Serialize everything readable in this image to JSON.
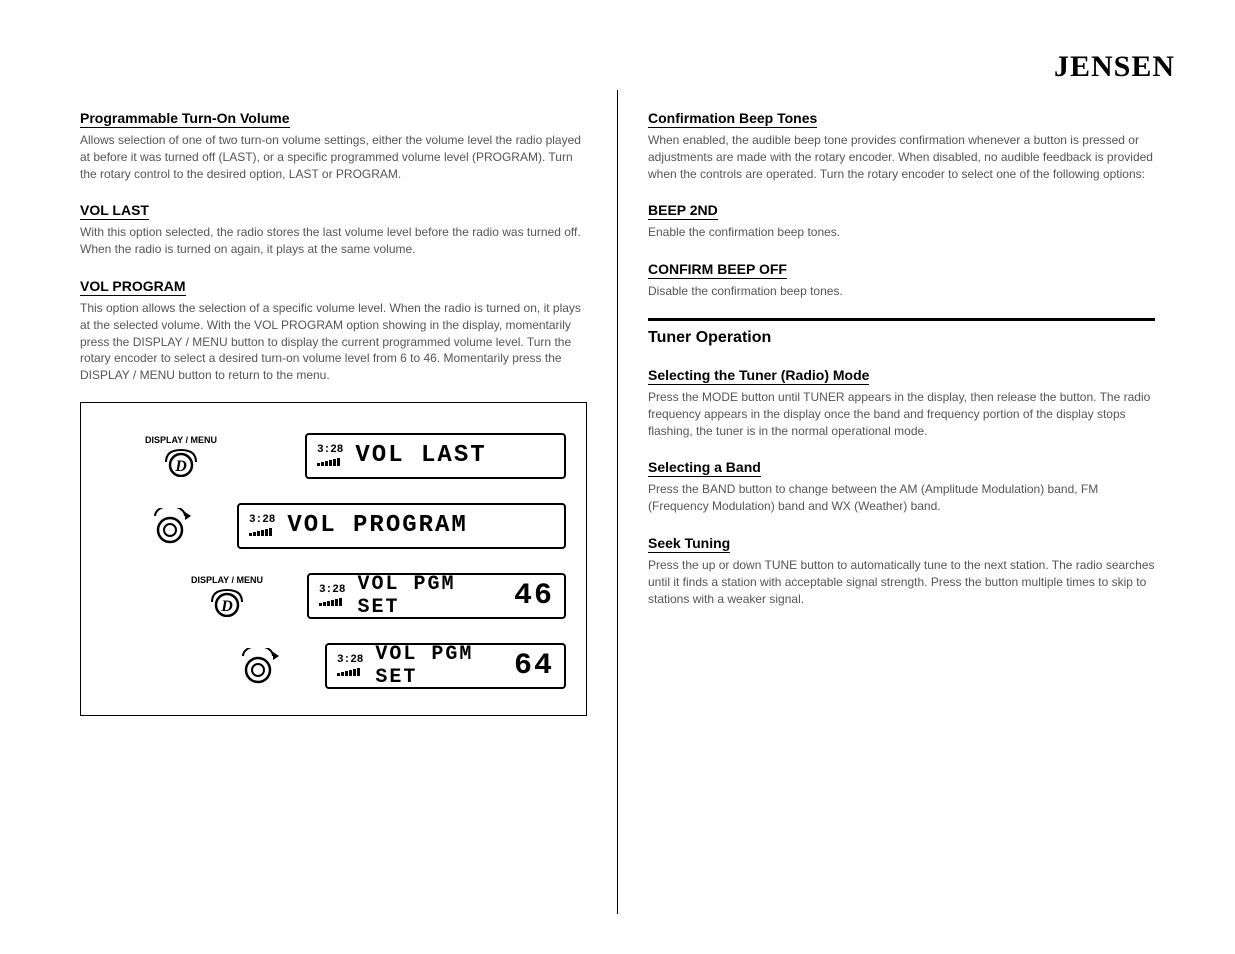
{
  "brand": "JENSEN",
  "left": {
    "sec1": {
      "title": "Programmable Turn-On Volume",
      "body": "Allows selection of one of two turn-on volume settings, either the volume level the radio played at before it was turned off (LAST), or a specific programmed volume level (PROGRAM). Turn the rotary control to the desired option, LAST or PROGRAM."
    },
    "last": {
      "title": "VOL LAST",
      "body": "With this option selected, the radio stores the last volume level before the radio was turned off. When the radio is turned on again, it plays at the same volume."
    },
    "program": {
      "title": "VOL PROGRAM",
      "body": "This option allows the selection of a specific volume level. When the radio is turned on, it plays at the selected volume. With the VOL PROGRAM option showing in the display, momentarily press the DISPLAY / MENU button to display the current programmed volume level. Turn the rotary encoder to select a desired turn-on volume level from 6 to 46. Momentarily press the DISPLAY / MENU button to return to the menu."
    },
    "illus": {
      "btnlabel": "DISPLAY / MENU",
      "clock": "3:28",
      "r1": "VOL LAST",
      "r2": "VOL PROGRAM",
      "r3a": "VOL PGM SET",
      "r3b": "46",
      "r4a": "VOL PGM SET",
      "r4b": "64"
    }
  },
  "right": {
    "beep": {
      "title": "Confirmation Beep Tones",
      "body": "When enabled, the audible beep tone provides confirmation whenever a button is pressed or adjustments are made with the rotary encoder. When disabled, no audible feedback is provided when the controls are operated. Turn the rotary encoder to select one of the following options:"
    },
    "on": {
      "title": "BEEP 2ND",
      "body": "Enable the confirmation beep tones."
    },
    "off": {
      "title": "CONFIRM BEEP OFF",
      "body": "Disable the confirmation beep tones."
    },
    "tuner_h": "Tuner Operation",
    "select": {
      "title": "Selecting the Tuner (Radio) Mode",
      "body": "Press the MODE button until TUNER appears in the display, then release the button. The radio frequency appears in the display once the band and frequency portion of the display stops flashing, the tuner is in the normal operational mode."
    },
    "band": {
      "title": "Selecting a Band",
      "body": "Press the BAND button to change between the AM (Amplitude Modulation) band, FM (Frequency Modulation) band and WX (Weather) band."
    },
    "seek": {
      "title": "Seek Tuning",
      "body": "Press the up or down TUNE button to automatically tune to the next station. The radio searches until it finds a station with acceptable signal strength. Press the button multiple times to skip to stations with a weaker signal."
    }
  }
}
